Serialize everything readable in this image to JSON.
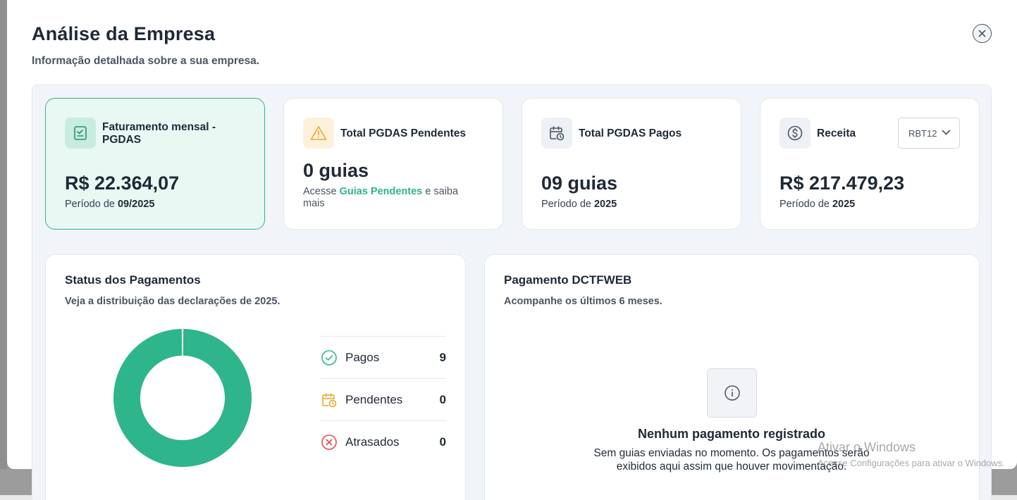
{
  "modal": {
    "title": "Análise da Empresa",
    "subtitle": "Informação detalhada sobre a sua empresa.",
    "close_icon": "close-icon"
  },
  "cards": {
    "faturamento": {
      "title": "Faturamento mensal - PGDAS",
      "value": "R$ 22.364,07",
      "period_label": "Período de",
      "period_value": "09/2025",
      "icon": "receipt-check-icon"
    },
    "pendentes": {
      "title": "Total PGDAS Pendentes",
      "value": "0 guias",
      "note_prefix": "Acesse",
      "note_link": "Guias Pendentes",
      "note_suffix": "e saiba mais",
      "icon": "warning-icon"
    },
    "pagos": {
      "title": "Total PGDAS Pagos",
      "value": "09 guias",
      "period_label": "Período de",
      "period_value": "2025",
      "icon": "calendar-clock-icon"
    },
    "receita": {
      "title": "Receita",
      "value": "R$ 217.479,23",
      "period_label": "Período de",
      "period_value": "2025",
      "select_value": "RBT12",
      "icon": "dollar-circle-icon"
    }
  },
  "status": {
    "title": "Status dos Pagamentos",
    "subtitle": "Veja a distribuição das declarações de 2025.",
    "legend": [
      {
        "label": "Pagos",
        "count": "9",
        "icon": "check-circle-icon",
        "color": "#2fb58b"
      },
      {
        "label": "Pendentes",
        "count": "0",
        "icon": "calendar-clock-icon",
        "color": "#e7a92b"
      },
      {
        "label": "Atrasados",
        "count": "0",
        "icon": "x-circle-icon",
        "color": "#e5484d"
      }
    ]
  },
  "chart_data": {
    "type": "pie",
    "categories": [
      "Pagos",
      "Pendentes",
      "Atrasados"
    ],
    "values": [
      9,
      0,
      0
    ],
    "colors": [
      "#2fb58b",
      "#e7a92b",
      "#e5484d"
    ],
    "donut": true
  },
  "dctfweb": {
    "title": "Pagamento DCTFWEB",
    "subtitle": "Acompanhe os últimos 6 meses.",
    "empty_title": "Nenhum pagamento registrado",
    "empty_text": "Sem guias enviadas no momento. Os pagamentos serão exibidos aqui assim que houver movimentação.",
    "empty_icon": "info-icon"
  },
  "watermark": {
    "line1": "Ativar o Windows",
    "line2": "Acesse Configurações para ativar o Windows."
  },
  "colors": {
    "accent": "#2fb58b",
    "warning": "#e7a92b",
    "danger": "#e5484d"
  }
}
